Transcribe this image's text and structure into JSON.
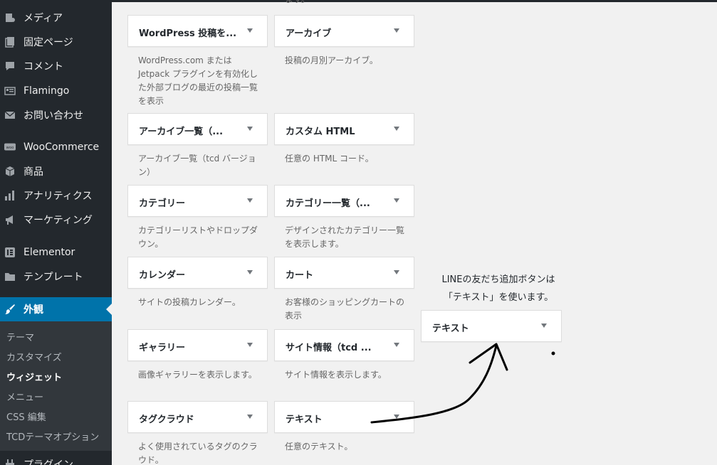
{
  "sidebar": {
    "items": [
      {
        "label": "メディア",
        "icon": "media-icon"
      },
      {
        "label": "固定ページ",
        "icon": "page-icon"
      },
      {
        "label": "コメント",
        "icon": "comment-icon"
      },
      {
        "label": "Flamingo",
        "icon": "flamingo-icon"
      },
      {
        "label": "お問い合わせ",
        "icon": "mail-icon"
      },
      {
        "label": "WooCommerce",
        "icon": "woocommerce-icon"
      },
      {
        "label": "商品",
        "icon": "product-icon"
      },
      {
        "label": "アナリティクス",
        "icon": "analytics-icon"
      },
      {
        "label": "マーケティング",
        "icon": "megaphone-icon"
      },
      {
        "label": "Elementor",
        "icon": "elementor-icon"
      },
      {
        "label": "テンプレート",
        "icon": "folder-icon"
      },
      {
        "label": "外観",
        "icon": "brush-icon"
      },
      {
        "label": "プラグイン",
        "icon": "plugin-icon"
      }
    ],
    "submenu": [
      "テーマ",
      "カスタマイズ",
      "ウィジェット",
      "メニュー",
      "CSS 編集",
      "TCDテーマオプション"
    ],
    "active_color": "#0073aa",
    "background": "#23282d"
  },
  "widgets": [
    {
      "title": "WordPress 投稿を...",
      "desc": "WordPress.com または Jetpack プラグインを有効化した外部ブログの最近の投稿一覧を表示"
    },
    {
      "title": "アーカイブ",
      "desc": "投稿の月別アーカイブ。"
    },
    {
      "title": "アーカイブ一覧（...",
      "desc": "アーカイブ一覧（tcd バージョン）"
    },
    {
      "title": "カスタム HTML",
      "desc": "任意の HTML コード。"
    },
    {
      "title": "カテゴリー",
      "desc": "カテゴリーリストやドロップダウン。"
    },
    {
      "title": "カテゴリー一覧（...",
      "desc": "デザインされたカテゴリー一覧を表示します。"
    },
    {
      "title": "カレンダー",
      "desc": "サイトの投稿カレンダー。"
    },
    {
      "title": "カート",
      "desc": "お客様のショッピングカートの表示"
    },
    {
      "title": "ギャラリー",
      "desc": "画像ギャラリーを表示します。"
    },
    {
      "title": "サイト情報（tcd ...",
      "desc": "サイト情報を表示します。"
    },
    {
      "title": "タグクラウド",
      "desc": "よく使用されているタグのクラウド。"
    },
    {
      "title": "テキスト",
      "desc": "任意のテキスト。"
    }
  ],
  "top_cut_text": "ます。",
  "annotation": {
    "line1": "LINEの友だち追加ボタンは",
    "line2": "「テキスト」を使います。",
    "widget_title": "テキスト"
  }
}
